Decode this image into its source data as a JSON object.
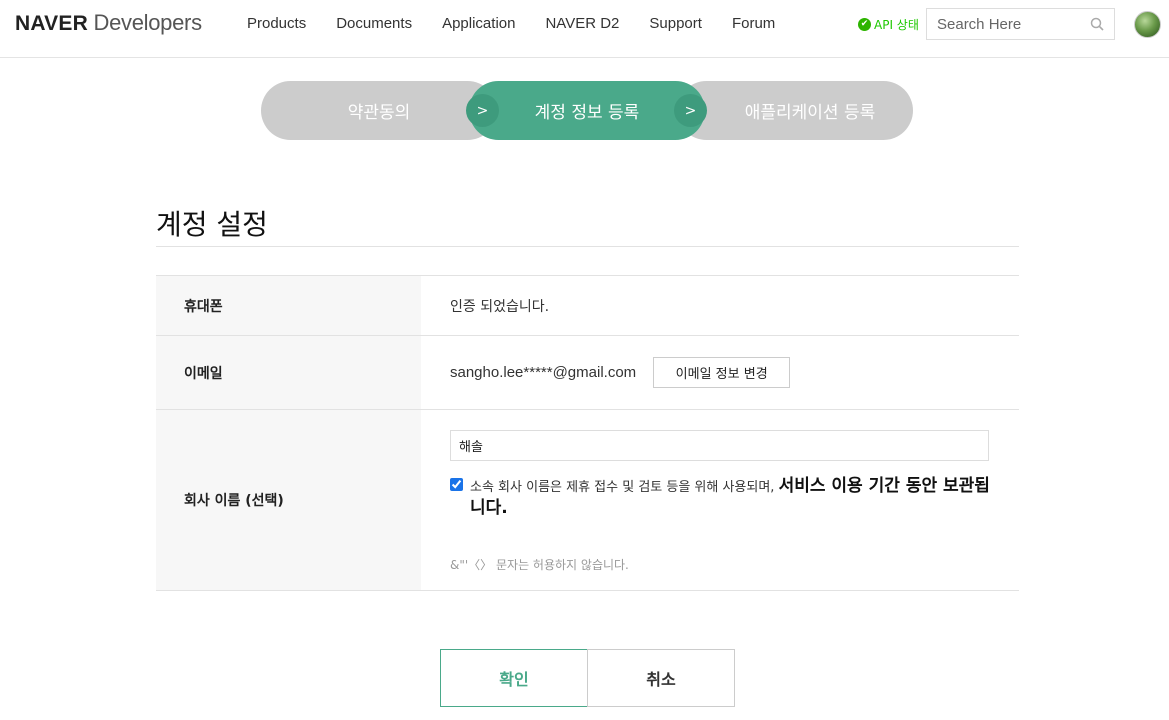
{
  "header": {
    "logo_brand": "NAVER",
    "logo_suffix": "Developers",
    "nav": [
      "Products",
      "Documents",
      "Application",
      "NAVER D2",
      "Support",
      "Forum"
    ],
    "api_status": "API 상태",
    "search_placeholder": "Search Here",
    "accent_color": "#2db400"
  },
  "stepper": {
    "steps": [
      "약관동의",
      "계정 정보 등록",
      "애플리케이션 등록"
    ],
    "active_index": 1,
    "active_color": "#4aa98a",
    "inactive_color": "#cccccc"
  },
  "page": {
    "title": "계정 설정"
  },
  "form": {
    "phone": {
      "label": "휴대폰",
      "value": "인증 되었습니다."
    },
    "email": {
      "label": "이메일",
      "value": "sangho.lee*****@gmail.com",
      "change_button": "이메일 정보 변경"
    },
    "company": {
      "label": "회사 이름 (선택)",
      "input_value": "해솔",
      "consent_checked": true,
      "consent_text": "소속 회사 이름은 제휴 접수 및 검토 등을 위해 사용되며, ",
      "consent_strong": "서비스 이용 기간 동안 보관됩니다.",
      "hint": "&\"'〈〉 문자는 허용하지 않습니다."
    }
  },
  "actions": {
    "confirm": "확인",
    "cancel": "취소"
  }
}
